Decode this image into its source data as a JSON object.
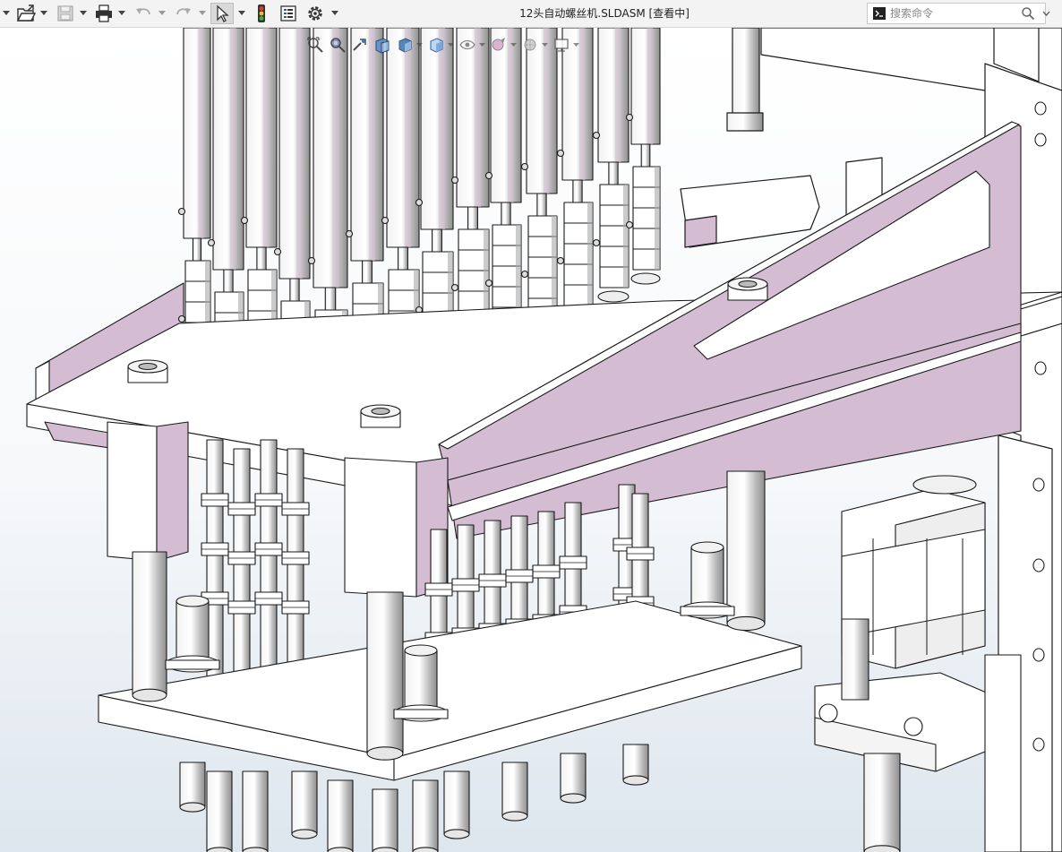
{
  "window": {
    "title": "12头自动螺丝机.SLDASM [查看中]"
  },
  "toolbar": {
    "items": [
      "menu-arrow-icon",
      "open-icon",
      "save-icon",
      "print-icon",
      "undo-icon",
      "redo-icon",
      "select-icon",
      "rebuild-icon",
      "file-properties-icon",
      "options-icon"
    ]
  },
  "search": {
    "placeholder": "搜索命令"
  },
  "colors": {
    "part_face": "#ffffff",
    "part_accent": "#d4bdd2",
    "edge": "#1a1a1a",
    "background_top": "#ffffff",
    "background_bottom": "#dde6ee",
    "metal_light": "#f2f2f2",
    "metal_dark": "#a9a9a9"
  },
  "heads_up_toolbar": {
    "items": [
      "zoom-to-fit-icon",
      "zoom-area-icon",
      "previous-view-icon",
      "section-view-icon",
      "view-orientation-icon",
      "display-style-icon",
      "hide-show-icon",
      "edit-appearance-icon",
      "apply-scene-icon",
      "view-settings-icon"
    ]
  }
}
